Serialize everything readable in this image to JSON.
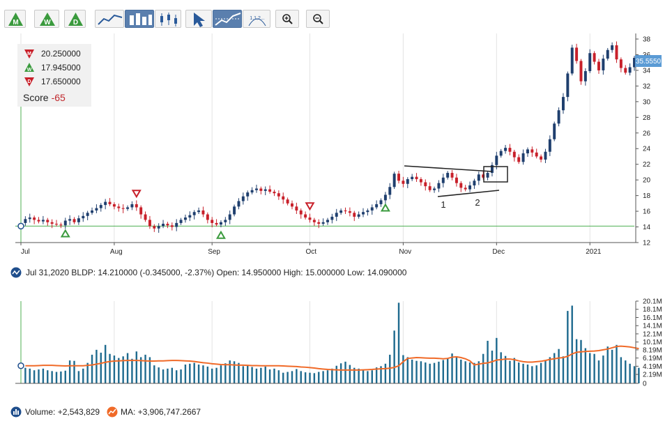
{
  "toolbar": {
    "period_buttons": [
      {
        "letter": "M",
        "icon": "monthly-period-icon"
      },
      {
        "letter": "W",
        "icon": "weekly-period-icon"
      },
      {
        "letter": "D",
        "icon": "daily-period-icon"
      }
    ],
    "chart_type_buttons": [
      "line-chart-icon",
      "bar-chart-icon",
      "candlestick-chart-icon"
    ],
    "tool_buttons": [
      "pointer-icon",
      "trendline-icon",
      "fibonacci-icon"
    ],
    "fib_label": "1,1,2,..",
    "zoom_buttons": [
      "zoom-in-icon",
      "zoom-out-icon"
    ],
    "colors": {
      "green": "#3a9a3d",
      "red": "#c8202a",
      "blue_active": "#5a7fae"
    }
  },
  "signals": {
    "monthly": {
      "letter": "M",
      "value": "20.250000",
      "direction": "down"
    },
    "weekly": {
      "letter": "W",
      "value": "17.945000",
      "direction": "up"
    },
    "daily": {
      "letter": "D",
      "value": "17.650000",
      "direction": "down"
    },
    "score_label": "Score",
    "score_value": "-65"
  },
  "price_info": {
    "text": "Jul 31,2020 BLDP: 14.210000 (-0.345000, -2.37%) Open: 14.950000 High: 15.000000 Low: 14.090000"
  },
  "volume_legend": {
    "volume_text": "Volume: +2,543,829",
    "ma_text": "MA: +3,906,747.2667"
  },
  "annotations": {
    "label_1": "1",
    "label_2": "2"
  },
  "chart_data": {
    "type": "candlestick",
    "price_axis": {
      "ticks": [
        "12",
        "14",
        "16",
        "18",
        "20",
        "22",
        "24",
        "26",
        "28",
        "30",
        "32",
        "34",
        "36",
        "38"
      ],
      "range": [
        12,
        38.5
      ],
      "last_price_label": "35.5550"
    },
    "volume_axis": {
      "ticks": [
        "0",
        "2.19M",
        "4.19M",
        "6.19M",
        "8.19M",
        "10.1M",
        "12.1M",
        "14.1M",
        "16.1M",
        "18.1M",
        "20.1M"
      ],
      "range": [
        0,
        20.1
      ]
    },
    "x_ticks": [
      "Jul",
      "Aug",
      "Sep",
      "Oct",
      "Nov",
      "Dec",
      "2021"
    ],
    "closes": [
      14.5,
      15.0,
      15.2,
      14.9,
      14.7,
      14.9,
      14.6,
      14.4,
      14.3,
      14.2,
      14.8,
      15.0,
      14.6,
      15.1,
      15.4,
      15.8,
      16.1,
      16.4,
      16.8,
      17.2,
      16.9,
      16.6,
      16.4,
      16.3,
      16.5,
      16.9,
      16.5,
      15.6,
      14.9,
      14.1,
      13.8,
      14.1,
      14.4,
      14.2,
      14.0,
      14.5,
      14.9,
      15.2,
      15.5,
      15.9,
      16.1,
      15.6,
      14.9,
      14.5,
      14.3,
      14.6,
      14.9,
      15.6,
      16.6,
      17.3,
      17.9,
      18.4,
      18.7,
      18.9,
      18.6,
      18.8,
      18.5,
      18.3,
      17.9,
      17.5,
      17.0,
      16.6,
      16.1,
      15.6,
      15.2,
      14.9,
      14.6,
      14.4,
      14.6,
      14.9,
      15.3,
      15.8,
      16.1,
      16.0,
      15.8,
      15.3,
      15.6,
      15.9,
      16.1,
      16.5,
      16.9,
      17.4,
      18.1,
      19.1,
      20.8,
      19.9,
      19.5,
      20.1,
      20.4,
      20.1,
      19.7,
      19.2,
      18.7,
      18.9,
      19.6,
      20.3,
      20.9,
      20.3,
      19.6,
      19.0,
      18.8,
      19.3,
      19.9,
      20.7,
      20.3,
      20.9,
      21.9,
      23.1,
      23.7,
      24.1,
      23.6,
      22.9,
      22.3,
      23.4,
      23.9,
      23.5,
      23.0,
      22.6,
      23.6,
      25.2,
      27.2,
      28.9,
      30.6,
      33.6,
      36.9,
      35.2,
      32.6,
      33.9,
      36.2,
      35.1,
      34.0,
      35.5,
      36.6,
      37.2,
      35.4,
      34.3,
      33.7,
      34.4,
      35.6
    ],
    "volumes": [
      3.8,
      3.6,
      3.2,
      3.4,
      3.6,
      3.2,
      3.0,
      2.8,
      2.9,
      3.1,
      5.6,
      5.5,
      3.0,
      3.6,
      5.0,
      7.0,
      8.2,
      7.5,
      9.4,
      7.2,
      6.8,
      6.2,
      6.6,
      7.4,
      6.0,
      7.8,
      6.4,
      7.0,
      6.4,
      4.4,
      3.9,
      3.4,
      3.6,
      3.8,
      3.2,
      3.4,
      4.6,
      4.8,
      5.0,
      4.6,
      4.4,
      4.1,
      3.6,
      3.8,
      4.4,
      4.9,
      5.6,
      5.4,
      5.0,
      4.2,
      4.4,
      4.0,
      3.6,
      3.8,
      4.1,
      3.4,
      3.6,
      3.2,
      2.6,
      2.8,
      3.0,
      3.5,
      3.0,
      2.7,
      2.6,
      2.5,
      2.8,
      3.0,
      3.2,
      3.6,
      4.3,
      4.9,
      5.3,
      4.5,
      3.8,
      3.6,
      3.4,
      3.0,
      3.2,
      3.9,
      4.2,
      4.8,
      7.0,
      12.9,
      19.7,
      6.9,
      6.4,
      5.8,
      5.5,
      5.4,
      5.1,
      4.8,
      5.0,
      5.3,
      5.7,
      6.2,
      7.3,
      6.4,
      5.8,
      5.4,
      5.1,
      5.0,
      5.4,
      7.2,
      10.4,
      8.0,
      11.1,
      7.6,
      6.7,
      5.5,
      6.2,
      5.1,
      4.8,
      4.6,
      4.2,
      4.4,
      5.0,
      5.6,
      6.4,
      7.4,
      8.4,
      6.6,
      17.7,
      19.0,
      10.8,
      10.6,
      8.6,
      7.4,
      7.2,
      5.6,
      6.8,
      9.0,
      8.2,
      9.4,
      6.4,
      5.6,
      4.8,
      4.2,
      3.8
    ],
    "ma": [
      4.3,
      4.3,
      4.3,
      4.35,
      4.4,
      4.4,
      4.4,
      4.35,
      4.3,
      4.25,
      4.3,
      4.3,
      4.3,
      4.3,
      4.4,
      4.5,
      4.7,
      4.9,
      5.15,
      5.35,
      5.45,
      5.5,
      5.55,
      5.6,
      5.6,
      5.6,
      5.55,
      5.5,
      5.45,
      5.45,
      5.5,
      5.5,
      5.55,
      5.6,
      5.6,
      5.55,
      5.5,
      5.45,
      5.35,
      5.2,
      5.05,
      4.95,
      4.8,
      4.7,
      4.6,
      4.55,
      4.55,
      4.5,
      4.45,
      4.45,
      4.4,
      4.35,
      4.35,
      4.3,
      4.3,
      4.3,
      4.3,
      4.3,
      4.25,
      4.2,
      4.15,
      4.1,
      4.0,
      3.95,
      3.85,
      3.75,
      3.6,
      3.5,
      3.4,
      3.35,
      3.3,
      3.25,
      3.25,
      3.25,
      3.25,
      3.25,
      3.3,
      3.35,
      3.4,
      3.5,
      3.55,
      3.6,
      3.7,
      3.9,
      4.3,
      5.3,
      6.1,
      6.2,
      6.3,
      6.25,
      6.2,
      6.15,
      6.15,
      6.1,
      6.0,
      6.1,
      6.4,
      6.5,
      6.3,
      6.0,
      5.5,
      4.5,
      4.7,
      4.9,
      5.0,
      5.3,
      5.7,
      5.8,
      5.95,
      5.95,
      5.8,
      5.5,
      5.3,
      5.2,
      5.2,
      5.3,
      5.4,
      5.6,
      5.85,
      6.0,
      6.2,
      6.3,
      6.6,
      7.2,
      7.6,
      7.7,
      7.8,
      7.85,
      7.9,
      8.0,
      8.2,
      8.4,
      8.7,
      9.0,
      9.1,
      9.0,
      8.9,
      8.7,
      8.5
    ],
    "signal_markers": [
      {
        "index": 10,
        "type": "up"
      },
      {
        "index": 26,
        "type": "down"
      },
      {
        "index": 45,
        "type": "up"
      },
      {
        "index": 65,
        "type": "down"
      },
      {
        "index": 82,
        "type": "up"
      }
    ],
    "cursor_index": 0,
    "support_level": 14.1
  }
}
